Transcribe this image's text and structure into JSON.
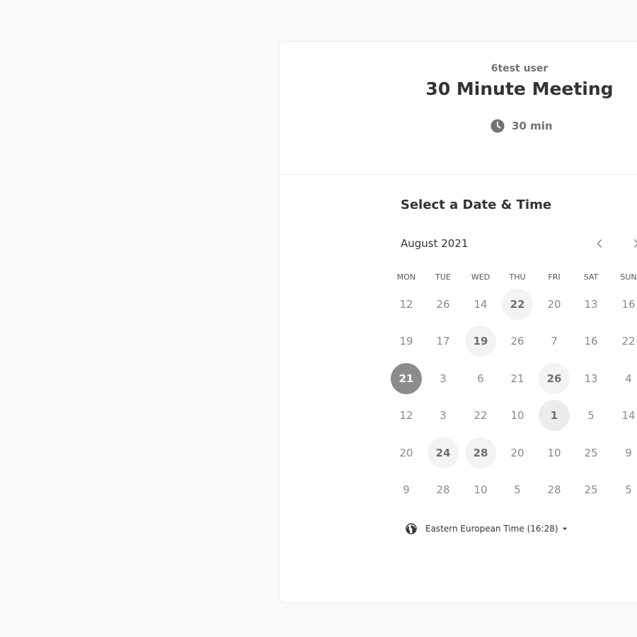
{
  "event": {
    "host": "6test user",
    "title": "30 Minute Meeting",
    "duration": "30 min",
    "duration_icon": "clock-icon"
  },
  "calendar": {
    "heading": "Select a Date & Time",
    "month": "August 2021",
    "prev_icon": "chevron-left-icon",
    "next_icon": "chevron-right-icon",
    "weekdays": [
      "MON",
      "TUE",
      "WED",
      "THU",
      "FRI",
      "SAT",
      "SUN"
    ],
    "weeks": [
      [
        {
          "label": "12",
          "state": "unavailable"
        },
        {
          "label": "26",
          "state": "unavailable"
        },
        {
          "label": "14",
          "state": "unavailable"
        },
        {
          "label": "22",
          "state": "available"
        },
        {
          "label": "20",
          "state": "unavailable"
        },
        {
          "label": "13",
          "state": "unavailable"
        },
        {
          "label": "16",
          "state": "unavailable"
        }
      ],
      [
        {
          "label": "19",
          "state": "unavailable"
        },
        {
          "label": "17",
          "state": "unavailable"
        },
        {
          "label": "19",
          "state": "available"
        },
        {
          "label": "26",
          "state": "unavailable"
        },
        {
          "label": "7",
          "state": "unavailable"
        },
        {
          "label": "16",
          "state": "unavailable"
        },
        {
          "label": "22",
          "state": "unavailable"
        }
      ],
      [
        {
          "label": "21",
          "state": "selected"
        },
        {
          "label": "3",
          "state": "unavailable"
        },
        {
          "label": "6",
          "state": "unavailable"
        },
        {
          "label": "21",
          "state": "unavailable"
        },
        {
          "label": "26",
          "state": "available"
        },
        {
          "label": "13",
          "state": "unavailable"
        },
        {
          "label": "4",
          "state": "unavailable"
        }
      ],
      [
        {
          "label": "12",
          "state": "unavailable"
        },
        {
          "label": "3",
          "state": "unavailable"
        },
        {
          "label": "22",
          "state": "unavailable"
        },
        {
          "label": "10",
          "state": "unavailable"
        },
        {
          "label": "1",
          "state": "available-today"
        },
        {
          "label": "5",
          "state": "unavailable"
        },
        {
          "label": "14",
          "state": "unavailable"
        }
      ],
      [
        {
          "label": "20",
          "state": "unavailable"
        },
        {
          "label": "24",
          "state": "available"
        },
        {
          "label": "28",
          "state": "available"
        },
        {
          "label": "20",
          "state": "unavailable"
        },
        {
          "label": "10",
          "state": "unavailable"
        },
        {
          "label": "25",
          "state": "unavailable"
        },
        {
          "label": "9",
          "state": "unavailable"
        }
      ],
      [
        {
          "label": "9",
          "state": "unavailable"
        },
        {
          "label": "28",
          "state": "unavailable"
        },
        {
          "label": "10",
          "state": "unavailable"
        },
        {
          "label": "5",
          "state": "unavailable"
        },
        {
          "label": "28",
          "state": "unavailable"
        },
        {
          "label": "25",
          "state": "unavailable"
        },
        {
          "label": "5",
          "state": "unavailable"
        }
      ]
    ]
  },
  "timezone": {
    "label": "Eastern European Time (16:28)",
    "icon": "globe-icon",
    "caret_icon": "caret-down-icon"
  },
  "colors": {
    "selected_day": "#8c8c8c",
    "available_day": "#f3f3f3",
    "page_background": "#fafafa"
  }
}
